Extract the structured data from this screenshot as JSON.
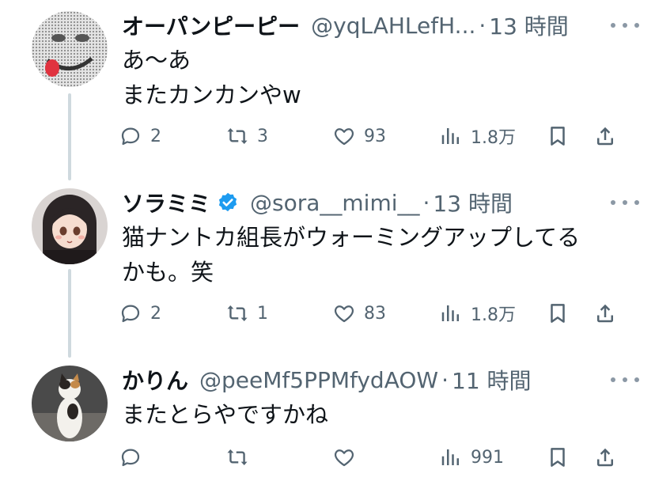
{
  "tweets": [
    {
      "name": "オーパンピーピー",
      "handle": "@yqLAHLefH...",
      "dot": "·",
      "time": "13 時間",
      "lines": [
        "あ〜あ",
        "またカンカンやw"
      ],
      "replies": "2",
      "retweets": "3",
      "likes": "93",
      "views": "1.8万",
      "verified": false
    },
    {
      "name": "ソラミミ",
      "handle": "@sora__mimi__",
      "dot": "·",
      "time": "13 時間",
      "lines": [
        "猫ナントカ組長がウォーミングアップしてる",
        "かも。笑"
      ],
      "replies": "2",
      "retweets": "1",
      "likes": "83",
      "views": "1.8万",
      "verified": true
    },
    {
      "name": "かりん",
      "handle": "@peeMf5PPMfydAOW",
      "dot": "·",
      "time": "11 時間",
      "lines": [
        "またとらやですかね"
      ],
      "replies": "",
      "retweets": "",
      "likes": "",
      "views": "991",
      "verified": false
    }
  ],
  "colors": {
    "text_primary": "#0f1419",
    "text_secondary": "#536471",
    "thread_line": "#cfd9de",
    "verified_badge": "#1d9bf0"
  },
  "icons": [
    "reply-icon",
    "retweet-icon",
    "like-icon",
    "views-icon",
    "bookmark-icon",
    "share-icon",
    "more-icon",
    "verified-badge-icon"
  ]
}
